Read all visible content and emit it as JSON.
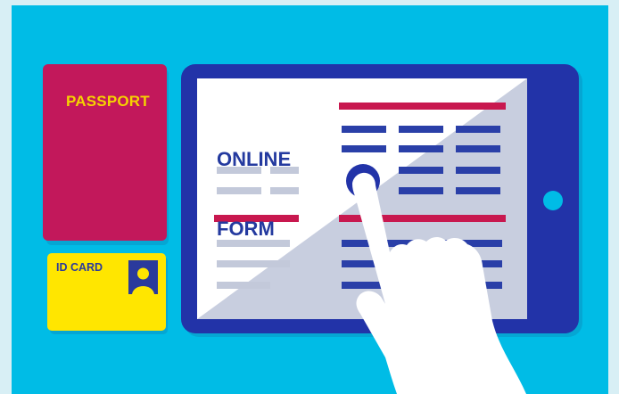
{
  "passport": {
    "label": "PASSPORT"
  },
  "id_card": {
    "label": "ID CARD"
  },
  "tablet": {
    "form_title_line1": "ONLINE",
    "form_title_line2": "FORM"
  },
  "icons": [
    "passport-icon",
    "id-card-icon",
    "portrait-icon",
    "tablet-icon",
    "home-button-icon",
    "pointing-hand-icon"
  ],
  "colors": {
    "background": "#00bce6",
    "passport": "#c2185b",
    "passport_text": "#f5d300",
    "id_card": "#ffe600",
    "id_card_text": "#2a3a9c",
    "tablet_frame": "#2233a8",
    "form_accent": "#c8184f",
    "form_title": "#243a9f",
    "form_lines": "#2a3fa8",
    "form_lines_light": "#c3c9da",
    "hand": "#ffffff"
  }
}
